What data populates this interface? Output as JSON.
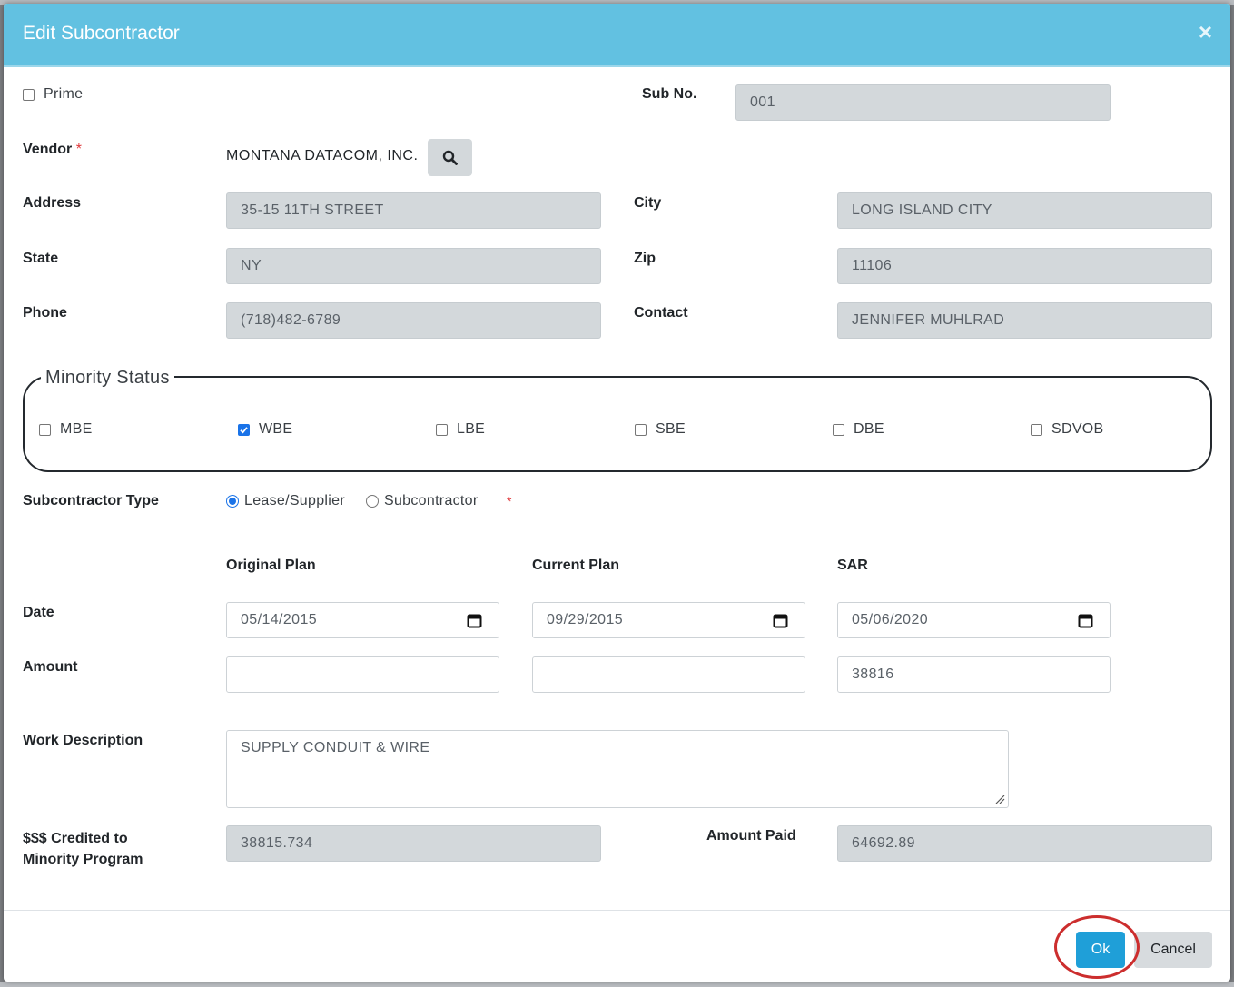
{
  "dialog": {
    "title": "Edit Subcontractor",
    "close_symbol": "×"
  },
  "prime": {
    "label": "Prime",
    "checked": false
  },
  "sub_no": {
    "label": "Sub No.",
    "value": "001"
  },
  "vendor": {
    "label": "Vendor",
    "required_mark": "*",
    "name": "MONTANA DATACOM, INC."
  },
  "address": {
    "label": "Address",
    "value": "35-15 11TH STREET"
  },
  "city": {
    "label": "City",
    "value": "LONG ISLAND CITY"
  },
  "state": {
    "label": "State",
    "value": "NY"
  },
  "zip": {
    "label": "Zip",
    "value": "11106"
  },
  "phone": {
    "label": "Phone",
    "value": "(718)482-6789"
  },
  "contact": {
    "label": "Contact",
    "value": "JENNIFER MUHLRAD"
  },
  "minority_status": {
    "legend": "Minority Status",
    "options": [
      {
        "label": "MBE",
        "checked": false
      },
      {
        "label": "WBE",
        "checked": true
      },
      {
        "label": "LBE",
        "checked": false
      },
      {
        "label": "SBE",
        "checked": false
      },
      {
        "label": "DBE",
        "checked": false
      },
      {
        "label": "SDVOB",
        "checked": false
      }
    ]
  },
  "subcontractor_type": {
    "label": "Subcontractor Type",
    "required_mark": "*",
    "options": [
      {
        "label": "Lease/Supplier",
        "selected": true
      },
      {
        "label": "Subcontractor",
        "selected": false
      }
    ]
  },
  "plan_columns": [
    "Original Plan",
    "Current Plan",
    "SAR"
  ],
  "date_row": {
    "label": "Date",
    "values": [
      "05/14/2015",
      "09/29/2015",
      "05/06/2020"
    ]
  },
  "amount_row": {
    "label": "Amount",
    "values": [
      "",
      "",
      "38816"
    ]
  },
  "work_description": {
    "label": "Work Description",
    "value": "SUPPLY CONDUIT & WIRE"
  },
  "credited": {
    "label_line1": "$$$ Credited to",
    "label_line2": "Minority Program",
    "value": "38815.734"
  },
  "amount_paid": {
    "label": "Amount Paid",
    "value": "64692.89"
  },
  "buttons": {
    "ok": "Ok",
    "cancel": "Cancel"
  },
  "colors": {
    "header": "#62c1e1",
    "ok_button": "#1f9fd8",
    "readonly_field": "#d3d8db",
    "highlight_ring": "#cc2e2e"
  }
}
